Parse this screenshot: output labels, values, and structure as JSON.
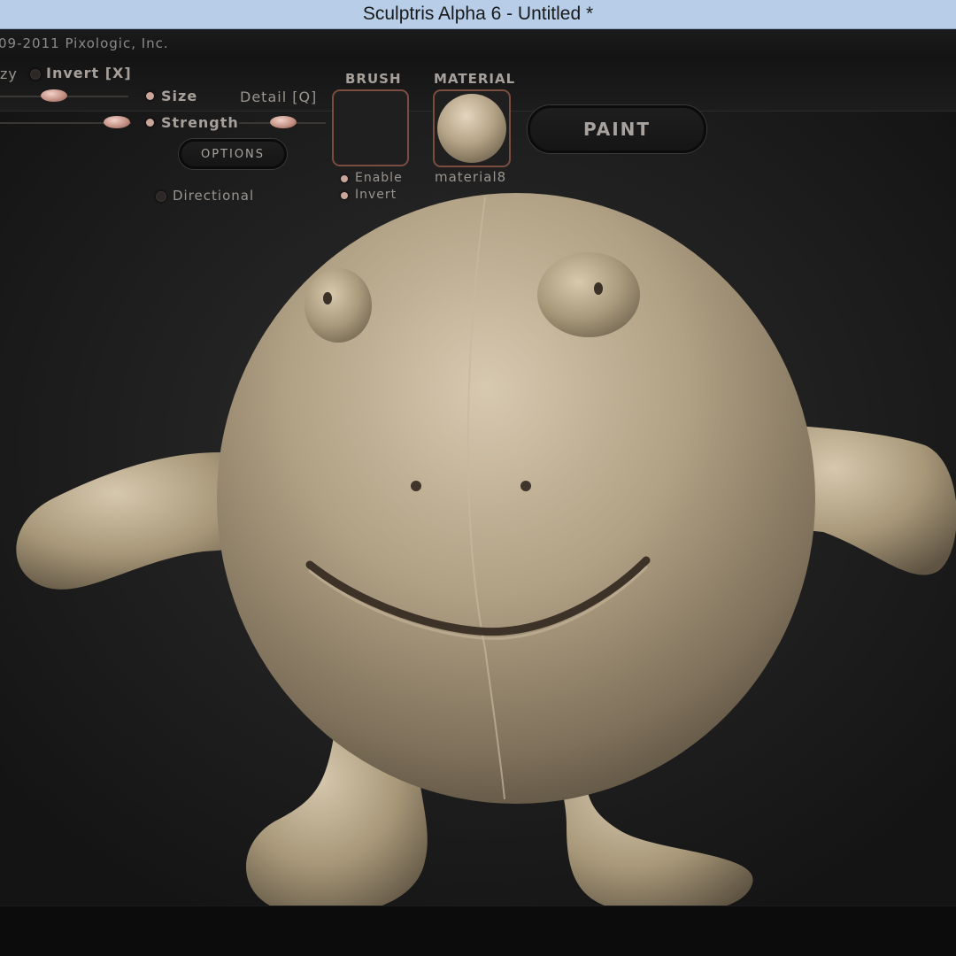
{
  "window": {
    "title": "Sculptris Alpha 6 - Untitled *"
  },
  "copyright": "09-2011 Pixologic, Inc.",
  "toolbar": {
    "symmetry_label": "zy",
    "invert_label": "Invert [X]",
    "size_label": "Size",
    "detail_label": "Detail [Q]",
    "strength_label": "Strength",
    "options_label": "OPTIONS",
    "directional_label": "Directional",
    "brush_heading": "BRUSH",
    "enable_label": "Enable",
    "brush_invert_label": "Invert",
    "material_heading": "MATERIAL",
    "material_name": "material8",
    "paint_label": "PAINT"
  },
  "colors": {
    "accent_dot": "#c9a59a",
    "frame": "#7a4d40",
    "clay": "#b4a386",
    "title_bar": "#b7cde8"
  },
  "icons": [
    "toggle-dot-icon",
    "slider-knob-icon",
    "material-sphere-icon"
  ]
}
